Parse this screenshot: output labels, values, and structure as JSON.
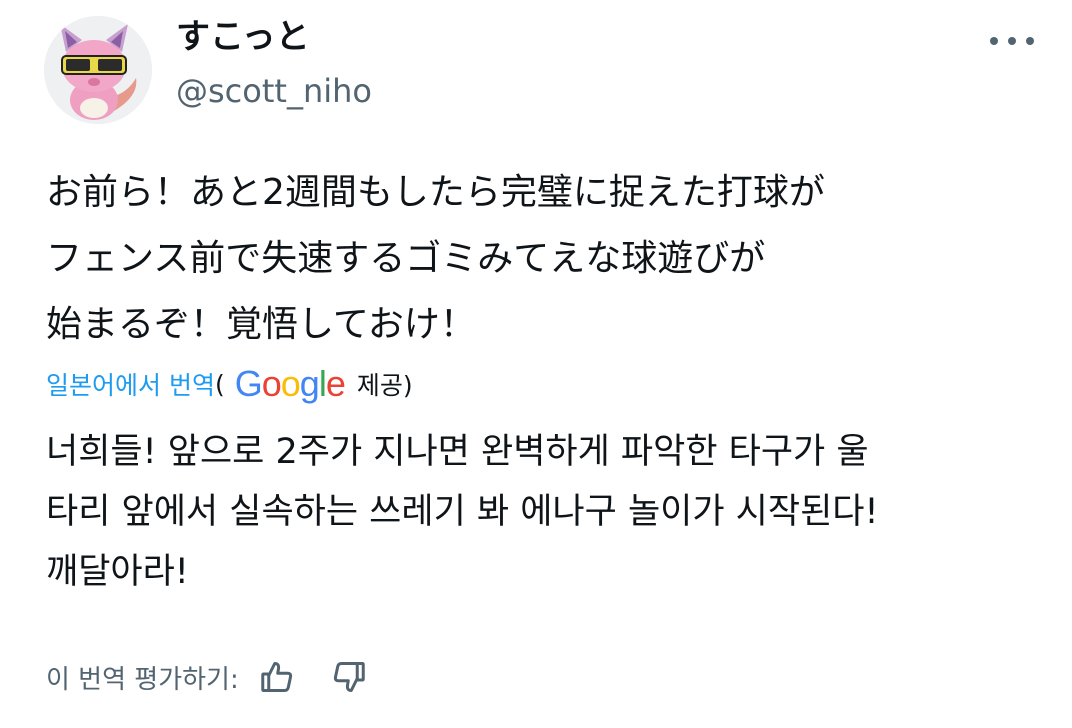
{
  "user": {
    "display_name": "すこっと",
    "handle": "@scott_niho",
    "avatar_icon": "fox-character-avatar-icon"
  },
  "tweet": {
    "text": "お前ら！あと2週間もしたら完璧に捉えた打球が\nフェンス前で失速するゴミみてえな球遊びが\n始まるぞ！覚悟しておけ！"
  },
  "translation": {
    "link_label": "일본어에서 번역",
    "paren_open": "(",
    "provider_logo": "Google",
    "provided_label": "제공)",
    "text": "너희들! 앞으로 2주가 지나면 완벽하게 파악한 타구가 울\n타리 앞에서 실속하는 쓰레기 봐 에나구 놀이가 시작된다!\n깨달아라!"
  },
  "rating": {
    "label": "이 번역 평가하기:",
    "up_icon": "thumbs-up-icon",
    "down_icon": "thumbs-down-icon"
  },
  "menu": {
    "more_icon": "more-options-icon"
  },
  "colors": {
    "link": "#1d9bf0",
    "secondary_text": "#536471",
    "primary_text": "#0f1419"
  }
}
